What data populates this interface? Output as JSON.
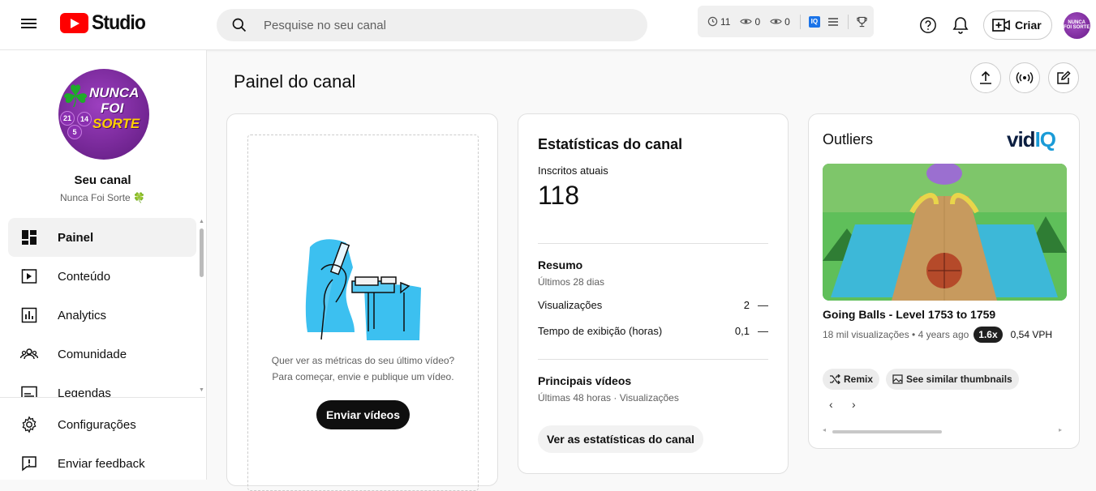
{
  "header": {
    "logo_text": "Studio",
    "search_placeholder": "Pesquise no seu canal",
    "vidiq_stats": [
      "11",
      "0",
      "0"
    ],
    "vidiq_badge": "IQ",
    "create_label": "Criar",
    "avatar_text": "NUNCA FOI SORTE"
  },
  "sidebar": {
    "channel_title": "Seu canal",
    "channel_name": "Nunca Foi Sorte 🍀",
    "avatar": {
      "line1": "NUNCA",
      "line2": "FOI",
      "line3": "SORTE",
      "balls": [
        "21",
        "14",
        "5"
      ]
    },
    "items": [
      {
        "label": "Painel",
        "icon": "dashboard-icon",
        "active": true
      },
      {
        "label": "Conteúdo",
        "icon": "content-icon"
      },
      {
        "label": "Analytics",
        "icon": "analytics-icon"
      },
      {
        "label": "Comunidade",
        "icon": "community-icon"
      },
      {
        "label": "Legendas",
        "icon": "subtitles-icon"
      }
    ],
    "bottom_items": [
      {
        "label": "Configurações",
        "icon": "gear-icon"
      },
      {
        "label": "Enviar feedback",
        "icon": "feedback-icon"
      }
    ]
  },
  "main": {
    "title": "Painel do canal",
    "upload_card": {
      "text_line1": "Quer ver as métricas do seu último vídeo?",
      "text_line2": "Para começar, envie e publique um vídeo.",
      "button": "Enviar vídeos"
    },
    "stats_card": {
      "title": "Estatísticas do canal",
      "subscribers_label": "Inscritos atuais",
      "subscribers_value": "118",
      "summary_title": "Resumo",
      "summary_sub": "Últimos 28 dias",
      "rows": [
        {
          "label": "Visualizações",
          "value": "2",
          "trend": "—"
        },
        {
          "label": "Tempo de exibição (horas)",
          "value": "0,1",
          "trend": "—"
        }
      ],
      "top_videos_title": "Principais vídeos",
      "top_videos_sub": "Últimas 48 horas · Visualizações",
      "button": "Ver as estatísticas do canal"
    },
    "outliers_card": {
      "title": "Outliers",
      "brand_vid": "vid",
      "brand_iq": "IQ",
      "video_title": "Going Balls - Level 1753 to 1759",
      "video_meta": "18 mil visualizações • 4 years ago",
      "multiplier": "1.6x",
      "vph": "0,54 VPH",
      "chip_remix": "Remix",
      "chip_similar": "See similar thumbnails",
      "prev": "‹",
      "next": "›"
    }
  },
  "colors": {
    "brand_red": "#ff0000",
    "vidiq_blue": "#1a9bd7",
    "avatar_purple": "#7a2a9b"
  }
}
